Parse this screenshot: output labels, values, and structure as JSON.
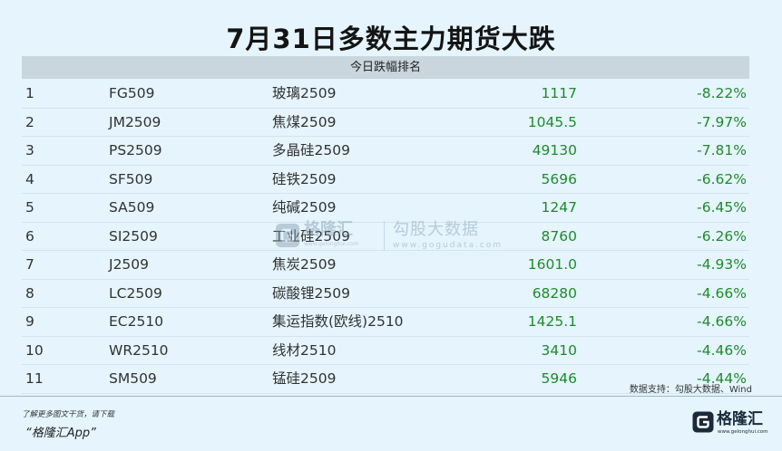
{
  "title": "7月31日多数主力期货大跌",
  "table": {
    "header": "今日跌幅排名",
    "rows": [
      {
        "rank": "1",
        "code": "FG509",
        "name": "玻璃2509",
        "price": "1117",
        "change": "-8.22%"
      },
      {
        "rank": "2",
        "code": "JM2509",
        "name": "焦煤2509",
        "price": "1045.5",
        "change": "-7.97%"
      },
      {
        "rank": "3",
        "code": "PS2509",
        "name": "多晶硅2509",
        "price": "49130",
        "change": "-7.81%"
      },
      {
        "rank": "4",
        "code": "SF509",
        "name": "硅铁2509",
        "price": "5696",
        "change": "-6.62%"
      },
      {
        "rank": "5",
        "code": "SA509",
        "name": "纯碱2509",
        "price": "1247",
        "change": "-6.45%"
      },
      {
        "rank": "6",
        "code": "SI2509",
        "name": "工业硅2509",
        "price": "8760",
        "change": "-6.26%"
      },
      {
        "rank": "7",
        "code": "J2509",
        "name": "焦炭2509",
        "price": "1601.0",
        "change": "-4.93%"
      },
      {
        "rank": "8",
        "code": "LC2509",
        "name": "碳酸锂2509",
        "price": "68280",
        "change": "-4.66%"
      },
      {
        "rank": "9",
        "code": "EC2510",
        "name": "集运指数(欧线)2510",
        "price": "1425.1",
        "change": "-4.66%"
      },
      {
        "rank": "10",
        "code": "WR2510",
        "name": "线材2510",
        "price": "3410",
        "change": "-4.46%"
      },
      {
        "rank": "11",
        "code": "SM509",
        "name": "锰硅2509",
        "price": "5946",
        "change": "-4.44%"
      }
    ]
  },
  "watermark": {
    "brand": "格隆汇",
    "brand_url": "www.gelonghui.com",
    "name": "勾股大数据",
    "url": "www.gogudata.com"
  },
  "source": "数据支持：勾股大数据、Wind",
  "footer": {
    "note": "了解更多图文干货，请下载",
    "app": "“格隆汇App”",
    "logo_text": "格隆汇",
    "logo_url": "www.gelonghui.com"
  },
  "colors": {
    "background": "#e5f4fd",
    "header_band": "#c9d6dd",
    "decline_green": "#1f8a2c"
  }
}
